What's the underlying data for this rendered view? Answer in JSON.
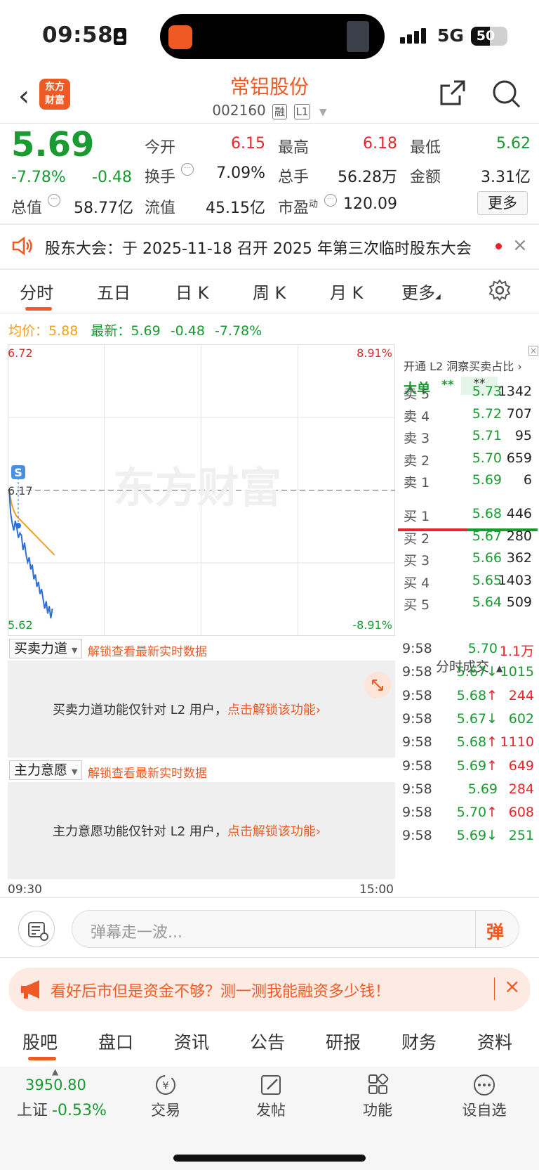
{
  "status": {
    "time": "09:58",
    "network": "5G",
    "battery": "50"
  },
  "header": {
    "back": "‹",
    "logo_line1": "东方",
    "logo_line2": "财富",
    "title": "常铝股份",
    "code": "002160",
    "tag1": "融",
    "tag2": "L1"
  },
  "quote": {
    "price": "5.69",
    "change_pct": "-7.78%",
    "change": "-0.48",
    "open_label": "今开",
    "open": "6.15",
    "high_label": "最高",
    "high": "6.18",
    "low_label": "最低",
    "low": "5.62",
    "turnover_label": "换手",
    "turnover": "7.09%",
    "volume_label": "总手",
    "volume": "56.28万",
    "amount_label": "金额",
    "amount": "3.31亿",
    "mktcap_label": "总值",
    "mktcap": "58.77亿",
    "float_label": "流值",
    "float": "45.15亿",
    "pe_label": "市盈",
    "pe_sup": "动",
    "pe": "120.09",
    "more": "更多"
  },
  "notice": {
    "text": "股东大会：于 2025-11-18 召开 2025 年第三次临时股东大会",
    "close": "×"
  },
  "tabs": [
    "分时",
    "五日",
    "日 K",
    "周 K",
    "月 K",
    "更多"
  ],
  "legend": {
    "avg_label": "均价：",
    "avg": "5.88",
    "last_label": "最新：",
    "last": "5.69",
    "chg": "-0.48",
    "pct": "-7.78%"
  },
  "chart_data": {
    "type": "line",
    "ylim": [
      5.62,
      6.72
    ],
    "y_top": "6.72",
    "y_bottom": "5.62",
    "y_mid": "6.17",
    "pct_top": "8.91%",
    "pct_bottom": "-8.91%",
    "x_start": "09:30",
    "x_end": "15:00",
    "watermark": "东方财富",
    "series": [
      {
        "values": [
          6.15,
          6.05,
          6.01,
          5.98,
          6.02,
          5.99,
          5.95,
          5.97,
          5.96,
          5.9,
          5.93,
          5.88,
          5.85,
          5.87,
          5.82,
          5.84,
          5.78,
          5.8,
          5.75,
          5.77,
          5.72,
          5.74,
          5.7,
          5.66,
          5.69,
          5.64,
          5.67,
          5.62,
          5.66
        ]
      },
      {
        "values": [
          6.15,
          6.09,
          6.06,
          6.04,
          6.03,
          6.02,
          6.01,
          6.0,
          5.99,
          5.98,
          5.97,
          5.96,
          5.95,
          5.94,
          5.93,
          5.92,
          5.91,
          5.9,
          5.89,
          5.88
        ]
      }
    ],
    "colors": {
      "price": "#2f6fd6",
      "avg": "#f0a020"
    }
  },
  "panel1": {
    "title": "买卖力道",
    "lock": "解锁查看最新实时数据",
    "msg": "买卖力道功能仅针对 L2 用户，",
    "link": "点击解锁该功能›"
  },
  "panel2": {
    "title": "主力意愿",
    "lock": "解锁查看最新实时数据",
    "msg": "主力意愿功能仅针对 L2 用户，",
    "link": "点击解锁该功能›"
  },
  "side": {
    "promo": "开通 L2 洞察买卖占比 ›",
    "big_label": "大单",
    "big1": "**",
    "big2": "**",
    "asks": [
      {
        "label": "卖 5",
        "price": "5.73",
        "vol": "1342"
      },
      {
        "label": "卖 4",
        "price": "5.72",
        "vol": "707"
      },
      {
        "label": "卖 3",
        "price": "5.71",
        "vol": "95"
      },
      {
        "label": "卖 2",
        "price": "5.70",
        "vol": "659"
      },
      {
        "label": "卖 1",
        "price": "5.69",
        "vol": "6"
      }
    ],
    "bids": [
      {
        "label": "买 1",
        "price": "5.68",
        "vol": "446"
      },
      {
        "label": "买 2",
        "price": "5.67",
        "vol": "280"
      },
      {
        "label": "买 3",
        "price": "5.66",
        "vol": "362"
      },
      {
        "label": "买 4",
        "price": "5.65",
        "vol": "1403"
      },
      {
        "label": "买 5",
        "price": "5.64",
        "vol": "509"
      }
    ],
    "trades_title": "分时成交",
    "trades": [
      {
        "time": "9:58",
        "price": "5.70",
        "vol": "1.1万",
        "dir": ""
      },
      {
        "time": "9:58",
        "price": "5.67↓",
        "vol": "1015",
        "dir": "down"
      },
      {
        "time": "9:58",
        "price": "5.68↑",
        "vol": "244",
        "dir": "up"
      },
      {
        "time": "9:58",
        "price": "5.67↓",
        "vol": "602",
        "dir": "down"
      },
      {
        "time": "9:58",
        "price": "5.68↑",
        "vol": "1110",
        "dir": "up"
      },
      {
        "time": "9:58",
        "price": "5.69↑",
        "vol": "649",
        "dir": "up"
      },
      {
        "time": "9:58",
        "price": "5.69",
        "vol": "284",
        "dir": ""
      },
      {
        "time": "9:58",
        "price": "5.70↑",
        "vol": "608",
        "dir": "up"
      },
      {
        "time": "9:58",
        "price": "5.69↓",
        "vol": "251",
        "dir": "down"
      }
    ]
  },
  "input": {
    "placeholder": "弹幕走一波...",
    "send": "弹"
  },
  "ad": {
    "text": "看好后市但是资金不够？测一测我能融资多少钱！",
    "close": "×"
  },
  "bottom_tabs": [
    "股吧",
    "盘口",
    "资讯",
    "公告",
    "研报",
    "财务",
    "资料"
  ],
  "nav": {
    "index_value": "3950.80",
    "index_name": "上证",
    "index_pct": "-0.53%",
    "trade": "交易",
    "post": "发帖",
    "func": "功能",
    "watch": "设自选"
  }
}
